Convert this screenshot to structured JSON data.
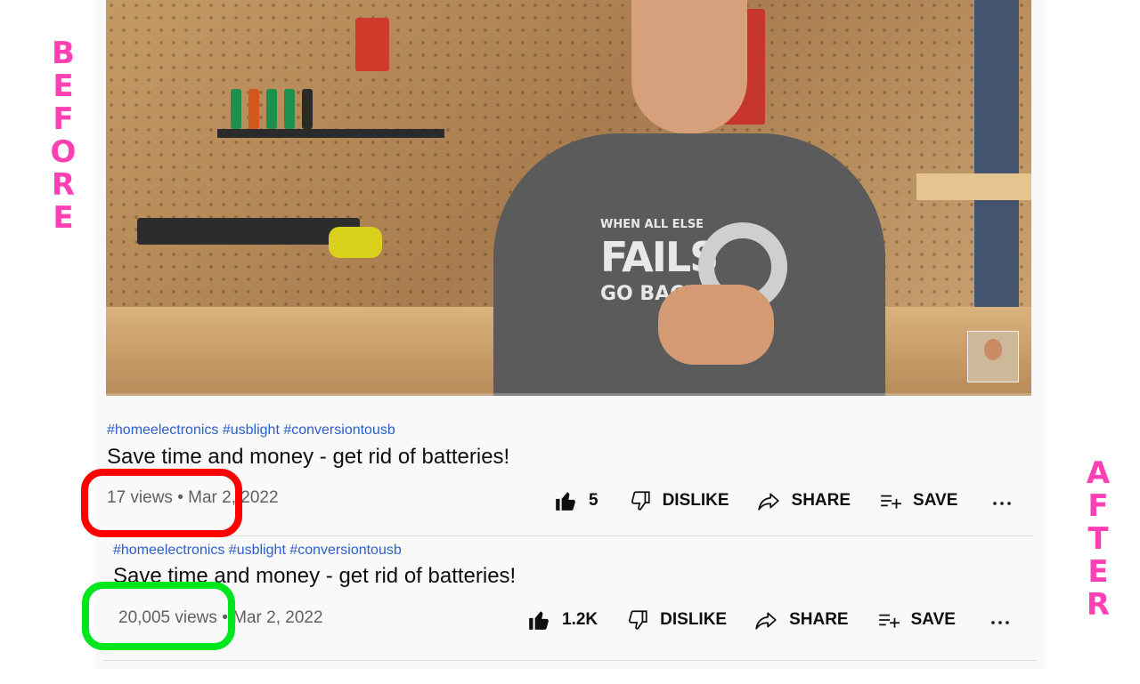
{
  "labels": {
    "before": "BEFORE",
    "after": "AFTER"
  },
  "before": {
    "hashtags": "#homeelectronics #usblight #conversiontousb",
    "title": "Save time and money - get rid of batteries!",
    "views": "17 views",
    "date": "Mar 2, 2022",
    "likes": "5",
    "dislike_label": "DISLIKE",
    "share_label": "SHARE",
    "save_label": "SAVE"
  },
  "after": {
    "hashtags": "#homeelectronics #usblight #conversiontousb",
    "title": "Save time and money - get rid of batteries!",
    "views": "20,005 views",
    "date": "Mar 2, 2022",
    "likes": "1.2K",
    "dislike_label": "DISLIKE",
    "share_label": "SHARE",
    "save_label": "SAVE"
  },
  "video": {
    "shirt_line1": "WHEN ALL ELSE",
    "shirt_line2": "FAILS",
    "shirt_line3": "GO BACK"
  },
  "colors": {
    "annotation_pink": "#ff3fb4",
    "highlight_red": "#ff0000",
    "highlight_green": "#00e61e",
    "link_blue": "#2a5fcd"
  }
}
